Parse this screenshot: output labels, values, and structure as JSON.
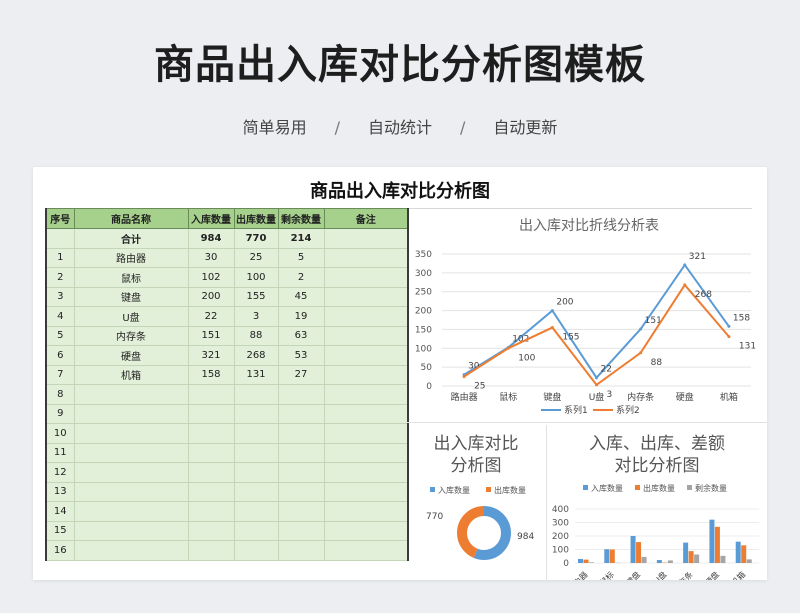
{
  "header": {
    "title": "商品出入库对比分析图模板",
    "tags": [
      "简单易用",
      "自动统计",
      "自动更新"
    ],
    "separator": "/"
  },
  "sheet": {
    "title": "商品出入库对比分析图",
    "columns": [
      "序号",
      "商品名称",
      "入库数量",
      "出库数量",
      "剩余数量",
      "备注"
    ],
    "total_row": {
      "label": "合计",
      "in": "984",
      "out": "770",
      "remain": "214"
    },
    "rows": [
      {
        "no": "1",
        "name": "路由器",
        "in": "30",
        "out": "25",
        "remain": "5"
      },
      {
        "no": "2",
        "name": "鼠标",
        "in": "102",
        "out": "100",
        "remain": "2"
      },
      {
        "no": "3",
        "name": "键盘",
        "in": "200",
        "out": "155",
        "remain": "45"
      },
      {
        "no": "4",
        "name": "U盘",
        "in": "22",
        "out": "3",
        "remain": "19"
      },
      {
        "no": "5",
        "name": "内存条",
        "in": "151",
        "out": "88",
        "remain": "63"
      },
      {
        "no": "6",
        "name": "硬盘",
        "in": "321",
        "out": "268",
        "remain": "53"
      },
      {
        "no": "7",
        "name": "机箱",
        "in": "158",
        "out": "131",
        "remain": "27"
      }
    ],
    "empty_row_numbers": [
      "8",
      "9",
      "10",
      "11",
      "12",
      "13",
      "14",
      "15",
      "16"
    ]
  },
  "colors": {
    "in": "#5b9bd5",
    "out": "#ed7d31",
    "remain": "#a5a5a5",
    "header_green": "#a6d18c",
    "cell_green": "#e2efd9"
  },
  "chart_data": [
    {
      "type": "line",
      "title": "出入库对比折线分析表",
      "categories": [
        "路由器",
        "鼠标",
        "键盘",
        "U盘",
        "内存条",
        "硬盘",
        "机箱"
      ],
      "series": [
        {
          "name": "系列1",
          "values": [
            30,
            102,
            200,
            22,
            151,
            321,
            158
          ]
        },
        {
          "name": "系列2",
          "values": [
            25,
            100,
            155,
            3,
            88,
            268,
            131
          ]
        }
      ],
      "point_labels": [
        [
          "30",
          "102",
          "200",
          "22",
          "151",
          "321",
          "158"
        ],
        [
          "25",
          "100",
          "155",
          "3",
          "88",
          "268",
          "131"
        ]
      ],
      "ylim": [
        0,
        350
      ],
      "yticks": [
        "0",
        "50",
        "100",
        "150",
        "200",
        "250",
        "300",
        "350"
      ],
      "legend": "bottom"
    },
    {
      "type": "pie",
      "variant": "donut",
      "title_lines": [
        "出入库对比",
        "分析图"
      ],
      "legend_entries": [
        "入库数量",
        "出库数量"
      ],
      "values": [
        984,
        770
      ],
      "value_labels": [
        "984",
        "770"
      ],
      "legend": "top"
    },
    {
      "type": "bar",
      "title_lines": [
        "入库、出库、差额",
        "对比分析图"
      ],
      "legend_entries": [
        "入库数量",
        "出库数量",
        "剩余数量"
      ],
      "categories": [
        "路由器",
        "鼠标",
        "键盘",
        "U盘",
        "内存条",
        "硬盘",
        "机箱"
      ],
      "series": [
        {
          "name": "入库数量",
          "values": [
            30,
            102,
            200,
            22,
            151,
            321,
            158
          ]
        },
        {
          "name": "出库数量",
          "values": [
            25,
            100,
            155,
            3,
            88,
            268,
            131
          ]
        },
        {
          "name": "剩余数量",
          "values": [
            5,
            2,
            45,
            19,
            63,
            53,
            27
          ]
        }
      ],
      "ylim": [
        0,
        400
      ],
      "yticks": [
        "0",
        "100",
        "200",
        "300",
        "400"
      ],
      "legend": "top"
    }
  ]
}
